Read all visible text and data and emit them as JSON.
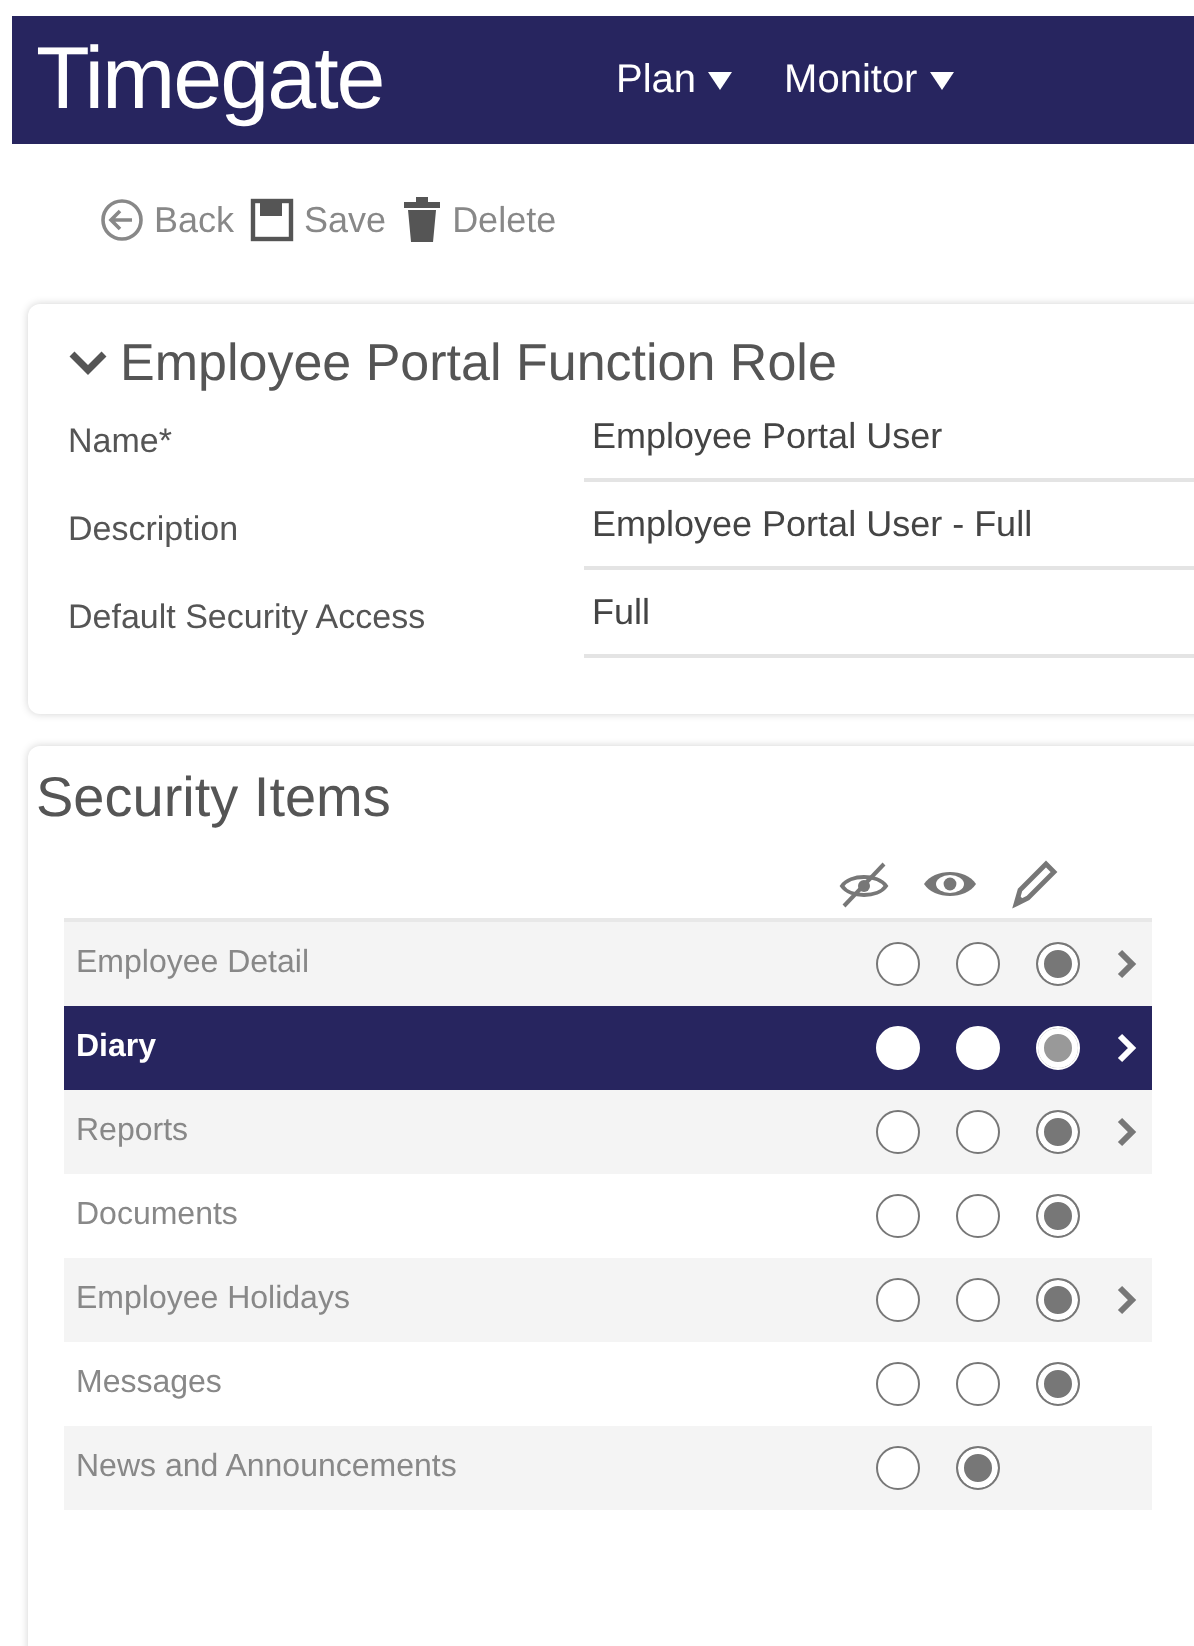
{
  "header": {
    "logo": "Timegate",
    "menus": [
      {
        "label": "Plan"
      },
      {
        "label": "Monitor"
      }
    ]
  },
  "toolbar": [
    {
      "kind": "back",
      "label": "Back"
    },
    {
      "kind": "save",
      "label": "Save"
    },
    {
      "kind": "delete",
      "label": "Delete"
    }
  ],
  "role_card": {
    "title": "Employee Portal Function Role",
    "expanded": true,
    "fields": [
      {
        "label": "Name*",
        "value": "Employee Portal User"
      },
      {
        "label": "Description",
        "value": "Employee Portal User - Full"
      },
      {
        "label": "Default Security Access",
        "value": "Full"
      }
    ]
  },
  "security": {
    "title": "Security Items",
    "columns": [
      {
        "kind": "hidden"
      },
      {
        "kind": "view"
      },
      {
        "kind": "edit"
      }
    ],
    "rows": [
      {
        "label": "Employee Detail",
        "selected": false,
        "has_children": true,
        "options": [
          {
            "selected": false
          },
          {
            "selected": false
          },
          {
            "selected": true
          }
        ]
      },
      {
        "label": "Diary",
        "selected": true,
        "has_children": true,
        "options": [
          {
            "selected": false
          },
          {
            "selected": false
          },
          {
            "selected": true
          }
        ]
      },
      {
        "label": "Reports",
        "selected": false,
        "has_children": true,
        "options": [
          {
            "selected": false
          },
          {
            "selected": false
          },
          {
            "selected": true
          }
        ]
      },
      {
        "label": "Documents",
        "selected": false,
        "has_children": false,
        "options": [
          {
            "selected": false
          },
          {
            "selected": false
          },
          {
            "selected": true
          }
        ]
      },
      {
        "label": "Employee Holidays",
        "selected": false,
        "has_children": true,
        "options": [
          {
            "selected": false
          },
          {
            "selected": false
          },
          {
            "selected": true
          }
        ]
      },
      {
        "label": "Messages",
        "selected": false,
        "has_children": false,
        "options": [
          {
            "selected": false
          },
          {
            "selected": false
          },
          {
            "selected": true
          }
        ]
      },
      {
        "label": "News and Announcements",
        "selected": false,
        "has_children": false,
        "options": [
          {
            "selected": false
          },
          {
            "selected": true
          }
        ]
      }
    ]
  }
}
